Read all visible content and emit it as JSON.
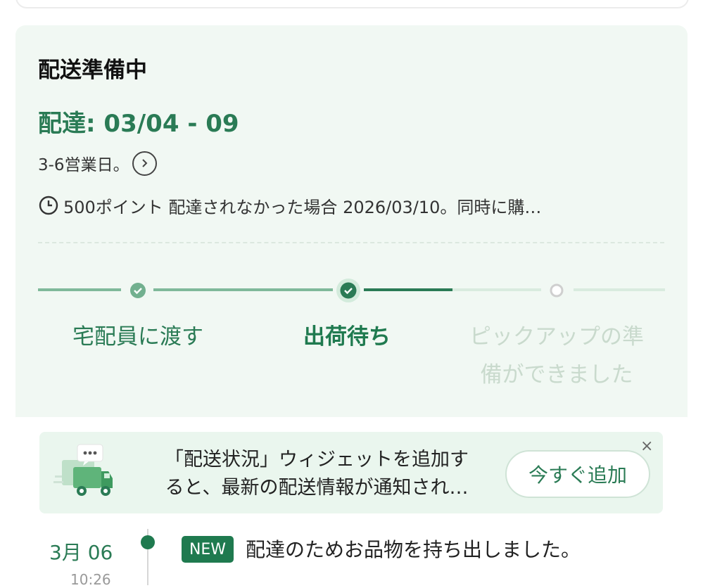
{
  "order_status": {
    "title": "配送準備中",
    "delivery_range": "配達: 03/04 - 09",
    "business_days": "3-6営業日。",
    "points_notice": "500ポイント 配達されなかった場合 2026/03/10。同時に購…"
  },
  "progress": {
    "steps": [
      {
        "label_line1": "宅配員に渡す",
        "label_line2": "",
        "state": "done"
      },
      {
        "label_line1": "出荷待ち",
        "label_line2": "",
        "state": "current"
      },
      {
        "label_line1": "ピックアップの準",
        "label_line2": "備ができました",
        "state": "pending"
      }
    ]
  },
  "widget_banner": {
    "text_line1": "「配送状況」ウィジェットを追加す",
    "text_line2": "ると、最新の配送情報が通知され…",
    "button_label": "今すぐ追加",
    "close_label": "×"
  },
  "timeline": [
    {
      "date": "3月 06",
      "time": "10:26",
      "badge": "NEW",
      "text": "配達のためお品物を持ち出しました。"
    }
  ],
  "colors": {
    "accent": "#1f7a4f",
    "card_bg": "#f1f8f3",
    "banner_bg": "#eaf6ee"
  }
}
